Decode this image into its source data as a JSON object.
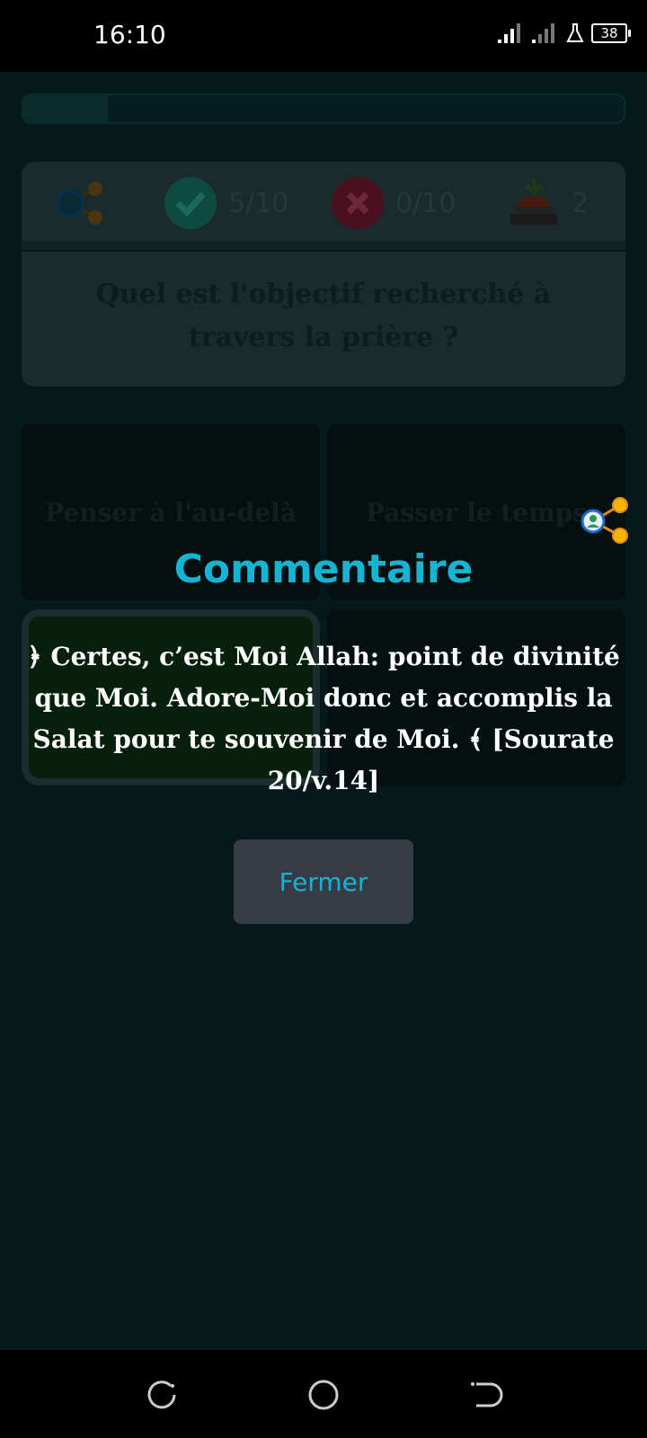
{
  "status_bar": {
    "time": "16:10",
    "battery": "38",
    "icons": [
      "signal-icon",
      "signal-icon",
      "flask-icon",
      "battery-icon"
    ]
  },
  "progress": {
    "fraction": 0.14
  },
  "stats": {
    "share_icon": "share-icon",
    "correct_icon": "check-circle-icon",
    "correct": "5/10",
    "wrong_icon": "cross-circle-icon",
    "wrong": "0/10",
    "hint_icon": "buzzer-icon",
    "hints": "2"
  },
  "question": "Quel est l'objectif recherché à travers la prière ?",
  "answers": [
    "Penser à l'au-delà",
    "Passer le temps",
    "",
    ""
  ],
  "dialog": {
    "title": "Commentaire",
    "body": "﴿ Certes, c’est Moi Allah: point de divinité que Moi. Adore-Moi donc et accomplis la Salat pour te souvenir de Moi. ﴾ [Sourate 20/v.14]",
    "close_label": "Fermer"
  },
  "colors": {
    "accent": "#16b4d3",
    "button_bg": "#363c46",
    "background": "#05191a"
  },
  "nav_bar": [
    "recents-icon",
    "home-icon",
    "back-icon"
  ]
}
